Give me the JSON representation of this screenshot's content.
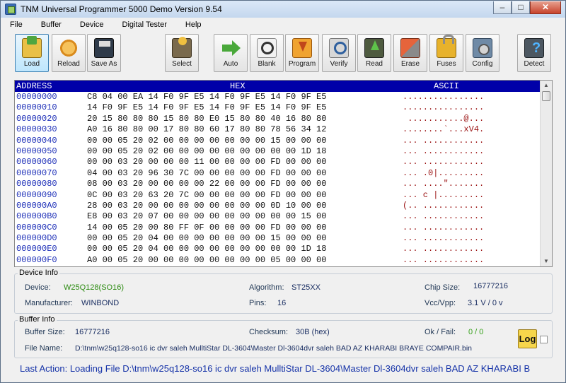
{
  "window": {
    "title": "TNM  Universal Programmer 5000 Demo  Version 9.54"
  },
  "menu": [
    "File",
    "Buffer",
    "Device",
    "Digital Tester",
    "Help"
  ],
  "toolbar": [
    {
      "name": "load",
      "label": "Load",
      "icon": "folder-open-icon",
      "active": true
    },
    {
      "name": "reload",
      "label": "Reload",
      "icon": "reload-icon"
    },
    {
      "name": "save-as",
      "label": "Save As",
      "icon": "floppy-disk-icon"
    },
    {
      "name": "select",
      "label": "Select",
      "icon": "chip-select-icon"
    },
    {
      "name": "auto",
      "label": "Auto",
      "icon": "green-arrow-icon"
    },
    {
      "name": "blank",
      "label": "Blank",
      "icon": "magnifier-icon"
    },
    {
      "name": "program",
      "label": "Program",
      "icon": "download-arrow-icon"
    },
    {
      "name": "verify",
      "label": "Verify",
      "icon": "verify-magnifier-icon"
    },
    {
      "name": "read",
      "label": "Read",
      "icon": "upload-arrow-icon"
    },
    {
      "name": "erase",
      "label": "Erase",
      "icon": "eraser-icon"
    },
    {
      "name": "fuses",
      "label": "Fuses",
      "icon": "padlock-icon"
    },
    {
      "name": "config",
      "label": "Config",
      "icon": "gear-config-icon"
    },
    {
      "name": "detect",
      "label": "Detect",
      "icon": "question-chip-icon"
    }
  ],
  "hex": {
    "headers": {
      "address": "ADDRESS",
      "hex": "HEX",
      "ascii": "ASCII"
    },
    "rows": [
      {
        "addr": "00000000",
        "hex": "C8 04 00 EA 14 F0 9F E5 14 F0 9F E5 14 F0 9F E5",
        "ascii": "................"
      },
      {
        "addr": "00000010",
        "hex": "14 F0 9F E5 14 F0 9F E5 14 F0 9F E5 14 F0 9F E5",
        "ascii": "................"
      },
      {
        "addr": "00000020",
        "hex": "20 15 80 80 80 15 80 80 E0 15 80 80 40 16 80 80",
        "ascii": " ...........@..."
      },
      {
        "addr": "00000030",
        "hex": "A0 16 80 80 00 17 80 80 60 17 80 80 78 56 34 12",
        "ascii": "........`...xV4."
      },
      {
        "addr": "00000040",
        "hex": "00 00 05 20 02 00 00 00 00 00 00 00 15 00 00 00",
        "ascii": "... ............"
      },
      {
        "addr": "00000050",
        "hex": "00 00 05 20 02 00 00 00 00 00 00 00 00 00 1D 18",
        "ascii": "... ............"
      },
      {
        "addr": "00000060",
        "hex": "00 00 03 20 00 00 00 11 00 00 00 00 FD 00 00 00",
        "ascii": "... ............"
      },
      {
        "addr": "00000070",
        "hex": "04 00 03 20 96 30 7C 00 00 00 00 00 FD 00 00 00",
        "ascii": "... .0|........."
      },
      {
        "addr": "00000080",
        "hex": "08 00 03 20 00 00 00 00 22 00 00 00 FD 00 00 00",
        "ascii": "... ....\"......."
      },
      {
        "addr": "00000090",
        "hex": "0C 00 03 20 63 20 7C 00 00 00 00 00 FD 00 00 00",
        "ascii": "... c |........."
      },
      {
        "addr": "000000A0",
        "hex": "28 00 03 20 00 00 00 00 00 00 00 00 0D 10 00 00",
        "ascii": "(.. ............"
      },
      {
        "addr": "000000B0",
        "hex": "E8 00 03 20 07 00 00 00 00 00 00 00 00 00 15 00",
        "ascii": "... ............"
      },
      {
        "addr": "000000C0",
        "hex": "14 00 05 20 00 80 FF 0F 00 00 00 00 FD 00 00 00",
        "ascii": "... ............"
      },
      {
        "addr": "000000D0",
        "hex": "00 00 05 20 04 00 00 00 00 00 00 00 15 00 00 00",
        "ascii": "... ............"
      },
      {
        "addr": "000000E0",
        "hex": "00 00 05 20 04 00 00 00 00 00 00 00 00 00 1D 18",
        "ascii": "... ............"
      },
      {
        "addr": "000000F0",
        "hex": "A0 00 05 20 00 00 00 00 00 00 00 00 05 00 00 00",
        "ascii": "... ............"
      }
    ]
  },
  "device_info": {
    "title": "Device Info",
    "device_label": "Device:",
    "device_value": "W25Q128(SO16)",
    "manufacturer_label": "Manufacturer:",
    "manufacturer_value": "WINBOND",
    "algorithm_label": "Algorithm:",
    "algorithm_value": "ST25XX",
    "pins_label": "Pins:",
    "pins_value": "16",
    "chipsize_label": "Chip Size:",
    "chipsize_value": "16777216",
    "vcc_label": "Vcc/Vpp:",
    "vcc_value": "3.1 V / 0 v"
  },
  "buffer_info": {
    "title": "Buffer Info",
    "size_label": "Buffer Size:",
    "size_value": "16777216",
    "checksum_label": "Checksum:",
    "checksum_value": "30B (hex)",
    "okfail_label": "Ok / Fail:",
    "okfail_value": "0 / 0",
    "filename_label": "File Name:",
    "filename_value": "D:\\tnm\\w25q128-so16 ic dvr saleh MulltiStar DL-3604\\Master Dl-3604dvr saleh BAD AZ KHARABI BRAYE COMPAIR.bin",
    "log_label": "Log"
  },
  "status": "Last Action:  Loading File  D:\\tnm\\w25q128-so16 ic dvr saleh MulltiStar DL-3604\\Master Dl-3604dvr saleh BAD AZ KHARABI B"
}
